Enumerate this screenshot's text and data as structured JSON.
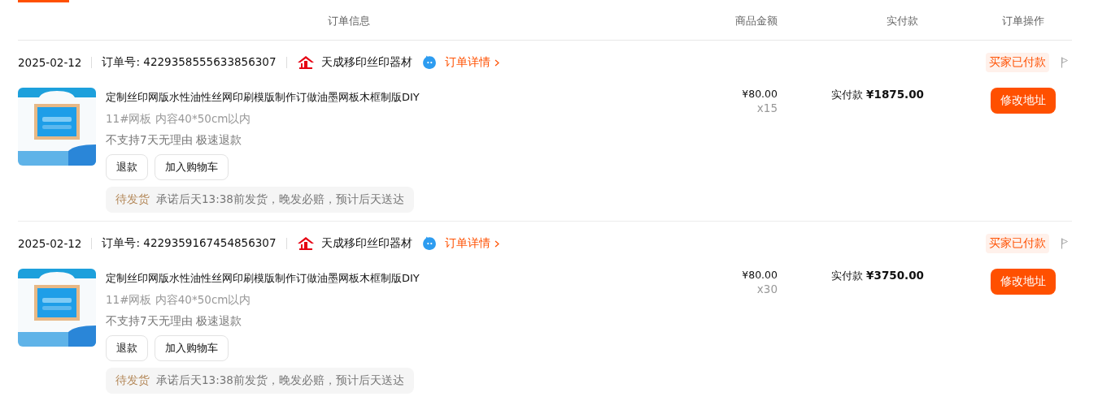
{
  "table": {
    "columns": [
      "订单信息",
      "商品金额",
      "实付款",
      "订单操作"
    ],
    "orders": [
      {
        "date": "2025-02-12",
        "order_no": "订单号: 4229358555633856307",
        "shop_name": "天成移印丝印器材",
        "detail_link": "订单详情",
        "status": "买家已付款",
        "product": {
          "title": "定制丝印网版水性油性丝网印刷模版制作订做油墨网板木框制版DIY",
          "spec": "11#网板 内容40*50cm以内",
          "service": "不支持7天无理由 极速退款",
          "buttons": [
            "退款",
            "加入购物车"
          ],
          "delivery_status": "待发货",
          "delivery_note": "承诺后天13:38前发货，晚发必赔，预计后天送达",
          "price": "¥80.00",
          "quantity": "x15",
          "paid_label": "实付款",
          "paid_amount": "¥1875.00",
          "action": "修改地址"
        }
      },
      {
        "date": "2025-02-12",
        "order_no": "订单号: 4229359167454856307",
        "shop_name": "天成移印丝印器材",
        "detail_link": "订单详情",
        "status": "买家已付款",
        "product": {
          "title": "定制丝印网版水性油性丝网印刷模版制作订做油墨网板木框制版DIY",
          "spec": "11#网板 内容40*50cm以内",
          "service": "不支持7天无理由 极速退款",
          "buttons": [
            "退款",
            "加入购物车"
          ],
          "delivery_status": "待发货",
          "delivery_note": "承诺后天13:38前发货，晚发必赔，预计后天送达",
          "price": "¥80.00",
          "quantity": "x30",
          "paid_label": "实付款",
          "paid_amount": "¥3750.00",
          "action": "修改地址"
        }
      }
    ]
  }
}
